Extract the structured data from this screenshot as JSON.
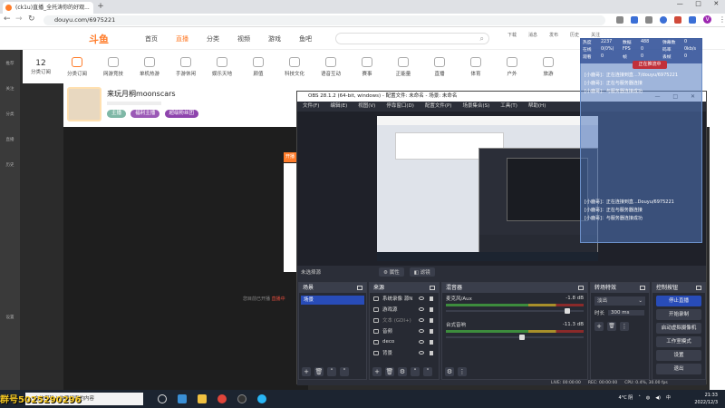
{
  "browser": {
    "tab_title": "(ck1u)直播_全托涛你的好观...",
    "url": "douyu.com/6975221",
    "not_secure": "不安全"
  },
  "douyu": {
    "logo": "斗鱼",
    "nav": [
      "首页",
      "直播",
      "分类",
      "视频",
      "游戏",
      "鱼吧"
    ],
    "header_right": [
      "下载",
      "消息",
      "发布",
      "历史",
      "关注"
    ],
    "categories": [
      {
        "label": "12",
        "sub": "分类订阅"
      },
      {
        "label": "分类订阅"
      },
      {
        "label": "网游竞技"
      },
      {
        "label": "单机热游"
      },
      {
        "label": "手游休闲"
      },
      {
        "label": "娱乐天地"
      },
      {
        "label": "颜值"
      },
      {
        "label": "科技文化"
      },
      {
        "label": "语音互动"
      },
      {
        "label": "赛事"
      },
      {
        "label": "正能量"
      },
      {
        "label": "直播"
      },
      {
        "label": "体育"
      },
      {
        "label": "户外"
      },
      {
        "label": "旅游"
      }
    ],
    "left_sidebar": [
      "推荐",
      "关注",
      "分类",
      "直播",
      "历史",
      "设置"
    ],
    "streamer_name": "来玩月桐moonscars",
    "tags": [
      {
        "text": "主播",
        "color": "#7fb8a6"
      },
      {
        "text": "福利主播",
        "color": "#9b59b6"
      },
      {
        "text": "超级粉丝团",
        "color": "#8e44ad"
      }
    ],
    "player_overlay_btn": "开播",
    "live_text": "您目前已开播 ",
    "live_highlight": "直播中"
  },
  "obs": {
    "title": "OBS 28.1.2 (64-bit, windows) - 配置文件: 未命名 - 场景: 未命名",
    "menu": [
      "文件(F)",
      "编辑(E)",
      "视图(V)",
      "停靠窗口(D)",
      "配置文件(P)",
      "场景集合(S)",
      "工具(T)",
      "帮助(H)"
    ],
    "ctx_no_source": "未选择源",
    "ctx_properties": "属性",
    "ctx_filters": "滤镜",
    "docks": {
      "scenes": {
        "title": "场景",
        "items": [
          "场景"
        ]
      },
      "sources": {
        "title": "来源",
        "items": [
          {
            "name": "系统录像 源N",
            "icon": "display-icon"
          },
          {
            "name": "游戏源",
            "icon": "gamepad-icon"
          },
          {
            "name": "文本 (GDI+)",
            "icon": "text-icon"
          },
          {
            "name": "音频",
            "icon": "audio-icon"
          },
          {
            "name": "deco",
            "icon": "image-icon"
          },
          {
            "name": "背景",
            "icon": "image-icon"
          }
        ]
      },
      "mixer": {
        "title": "混音器",
        "tracks": [
          {
            "name": "麦克风/Aux",
            "db": "-1.8 dB",
            "level": 0.88
          },
          {
            "name": "台式音响",
            "db": "-11.3 dB",
            "level": 0.55
          }
        ]
      },
      "transitions": {
        "title": "转场特效",
        "type": "淡出",
        "duration_label": "时长",
        "duration": "300 ms"
      },
      "controls": {
        "title": "控制按钮",
        "buttons": [
          "停止直播",
          "开始录制",
          "启动虚拟摄像机",
          "工作室模式",
          "设置",
          "退出"
        ]
      }
    },
    "status": {
      "live": "LIVE: 00:00:00",
      "rec": "REC: 00:00:00",
      "cpu": "CPU: 0.4%, 30.00 fps"
    }
  },
  "overlay": {
    "stats": [
      [
        "热度",
        "2237",
        "数据",
        "488",
        "弹幕数",
        "0"
      ],
      [
        "在线",
        "0(0%)",
        "FPS",
        "0",
        "码率",
        "0kb/s"
      ],
      [
        "观看",
        "0",
        "帧",
        "0",
        "丢帧",
        "0"
      ]
    ],
    "red_badge": "正在推流中",
    "lines": [
      "[小鹿哥]：正在连接到直...7/douyu/6975221",
      "[小鹿哥]：正在与服务器连接",
      "[小鹿哥]：与服务器连接成功"
    ],
    "lines2": [
      "[小鹿哥]：正在连接到直...Douyu/6975221",
      "[小鹿哥]：正在与服务器连接",
      "[小鹿哥]：与服务器连接成功"
    ]
  },
  "taskbar": {
    "search_placeholder": "在这里输入你要搜索的内容",
    "weather": "4°C 阴",
    "time": "21:33",
    "date": "2022/12/3",
    "ime": "中"
  },
  "watermark": "群号5025290296"
}
